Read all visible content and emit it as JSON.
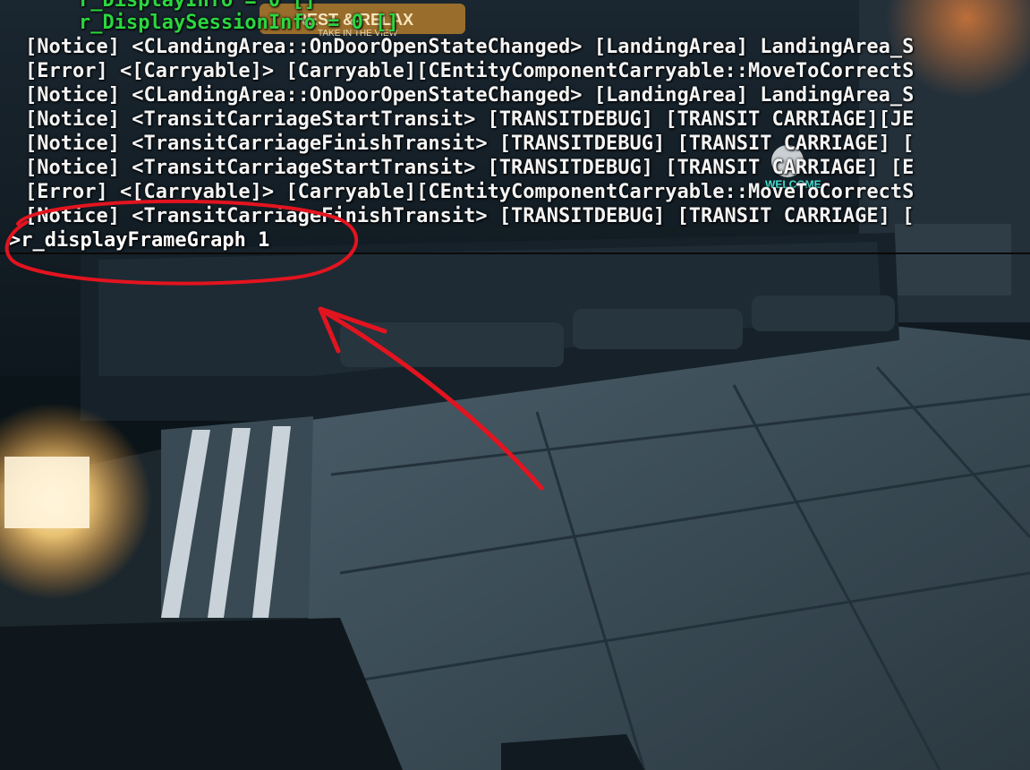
{
  "console": {
    "cvars": [
      "r_DisplayInfo = 0 []",
      "r_DisplaySessionInfo = 0 []"
    ],
    "log_lines": [
      "[Notice] <CLandingArea::OnDoorOpenStateChanged> [LandingArea] LandingArea_S",
      "[Error] <[Carryable]> [Carryable][CEntityComponentCarryable::MoveToCorrectS",
      "[Notice] <CLandingArea::OnDoorOpenStateChanged> [LandingArea] LandingArea_S",
      "[Notice] <TransitCarriageStartTransit> [TRANSITDEBUG] [TRANSIT CARRIAGE][JE",
      "[Notice] <TransitCarriageFinishTransit> [TRANSITDEBUG] [TRANSIT CARRIAGE] [",
      "[Notice] <TransitCarriageStartTransit> [TRANSITDEBUG] [TRANSIT CARRIAGE] [E",
      "[Error] <[Carryable]> [Carryable][CEntityComponentCarryable::MoveToCorrectS",
      "[Notice] <TransitCarriageFinishTransit> [TRANSITDEBUG] [TRANSIT CARRIAGE] ["
    ],
    "input_command": ">r_displayFrameGraph 1"
  },
  "scene_signs": {
    "rest_relax": "REST & RELAX",
    "take_in_view": "TAKE IN THE VIEW",
    "welcome": "WELCOME"
  },
  "colors": {
    "cvar_text": "#2bd63f",
    "log_text": "#f4f4f4",
    "annotation": "#e2141f"
  }
}
